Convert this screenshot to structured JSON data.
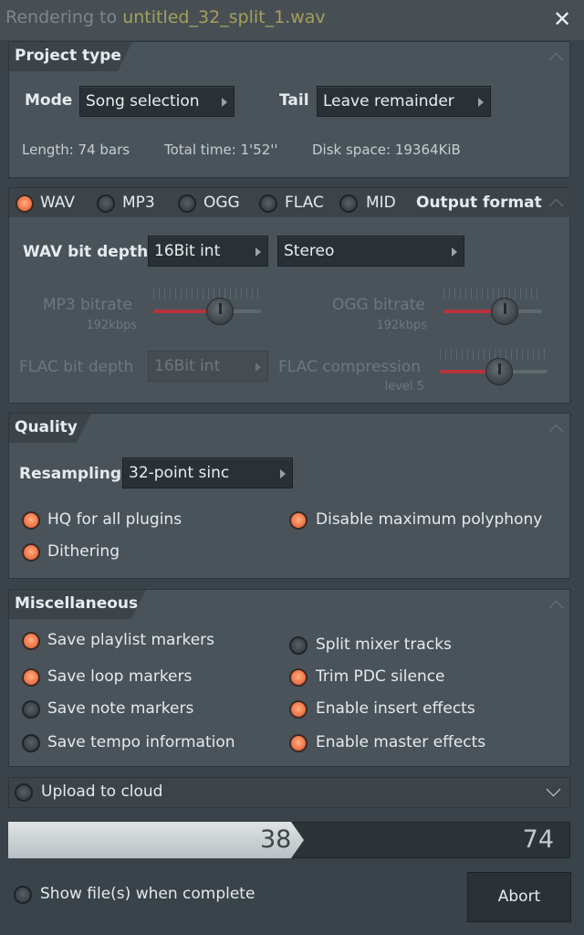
{
  "window": {
    "title_prefix": "Rendering to ",
    "title_file": "untitled_32_split_1.wav"
  },
  "project_type": {
    "header": "Project type",
    "mode_label": "Mode",
    "mode_value": "Song selection",
    "tail_label": "Tail",
    "tail_value": "Leave remainder",
    "length": "Length: 74 bars",
    "total_time": "Total time: 1'52''",
    "disk_space": "Disk space: 19364KiB"
  },
  "output_format": {
    "header": "Output format",
    "formats": [
      {
        "label": "WAV",
        "selected": true
      },
      {
        "label": "MP3",
        "selected": false
      },
      {
        "label": "OGG",
        "selected": false
      },
      {
        "label": "FLAC",
        "selected": false
      },
      {
        "label": "MID",
        "selected": false
      }
    ],
    "wav_bit_depth_label": "WAV bit depth",
    "wav_bit_depth_value": "16Bit int",
    "channels_value": "Stereo",
    "mp3_bitrate_label": "MP3 bitrate",
    "mp3_bitrate_value": "192kbps",
    "mp3_bitrate_level": 0.62,
    "ogg_bitrate_label": "OGG bitrate",
    "ogg_bitrate_value": "192kbps",
    "ogg_bitrate_level": 0.62,
    "flac_bit_depth_label": "FLAC bit depth",
    "flac_bit_depth_value": "16Bit int",
    "flac_compression_label": "FLAC compression",
    "flac_compression_value": "level 5",
    "flac_compression_level": 0.55
  },
  "quality": {
    "header": "Quality",
    "resampling_label": "Resampling",
    "resampling_value": "32-point sinc",
    "hq_plugins": "HQ for all plugins",
    "hq_plugins_on": true,
    "disable_polyphony": "Disable maximum polyphony",
    "disable_polyphony_on": true,
    "dithering": "Dithering",
    "dithering_on": true
  },
  "misc": {
    "header": "Miscellaneous",
    "save_playlist_markers": "Save playlist markers",
    "save_loop_markers": "Save loop markers",
    "save_note_markers": "Save note markers",
    "save_tempo_information": "Save tempo information",
    "split_mixer_tracks": "Split mixer tracks",
    "trim_pdc_silence": "Trim PDC silence",
    "enable_insert_effects": "Enable insert effects",
    "enable_master_effects": "Enable master effects"
  },
  "upload": {
    "label": "Upload to cloud"
  },
  "progress": {
    "current": "38",
    "total": "74",
    "fraction": 0.5135
  },
  "footer": {
    "show_files_label": "Show file(s) when complete",
    "abort_label": "Abort"
  },
  "colors": {
    "accent_orange": "#f27a4d",
    "knob_red": "#b8333c",
    "title_file": "#a5a05a"
  }
}
